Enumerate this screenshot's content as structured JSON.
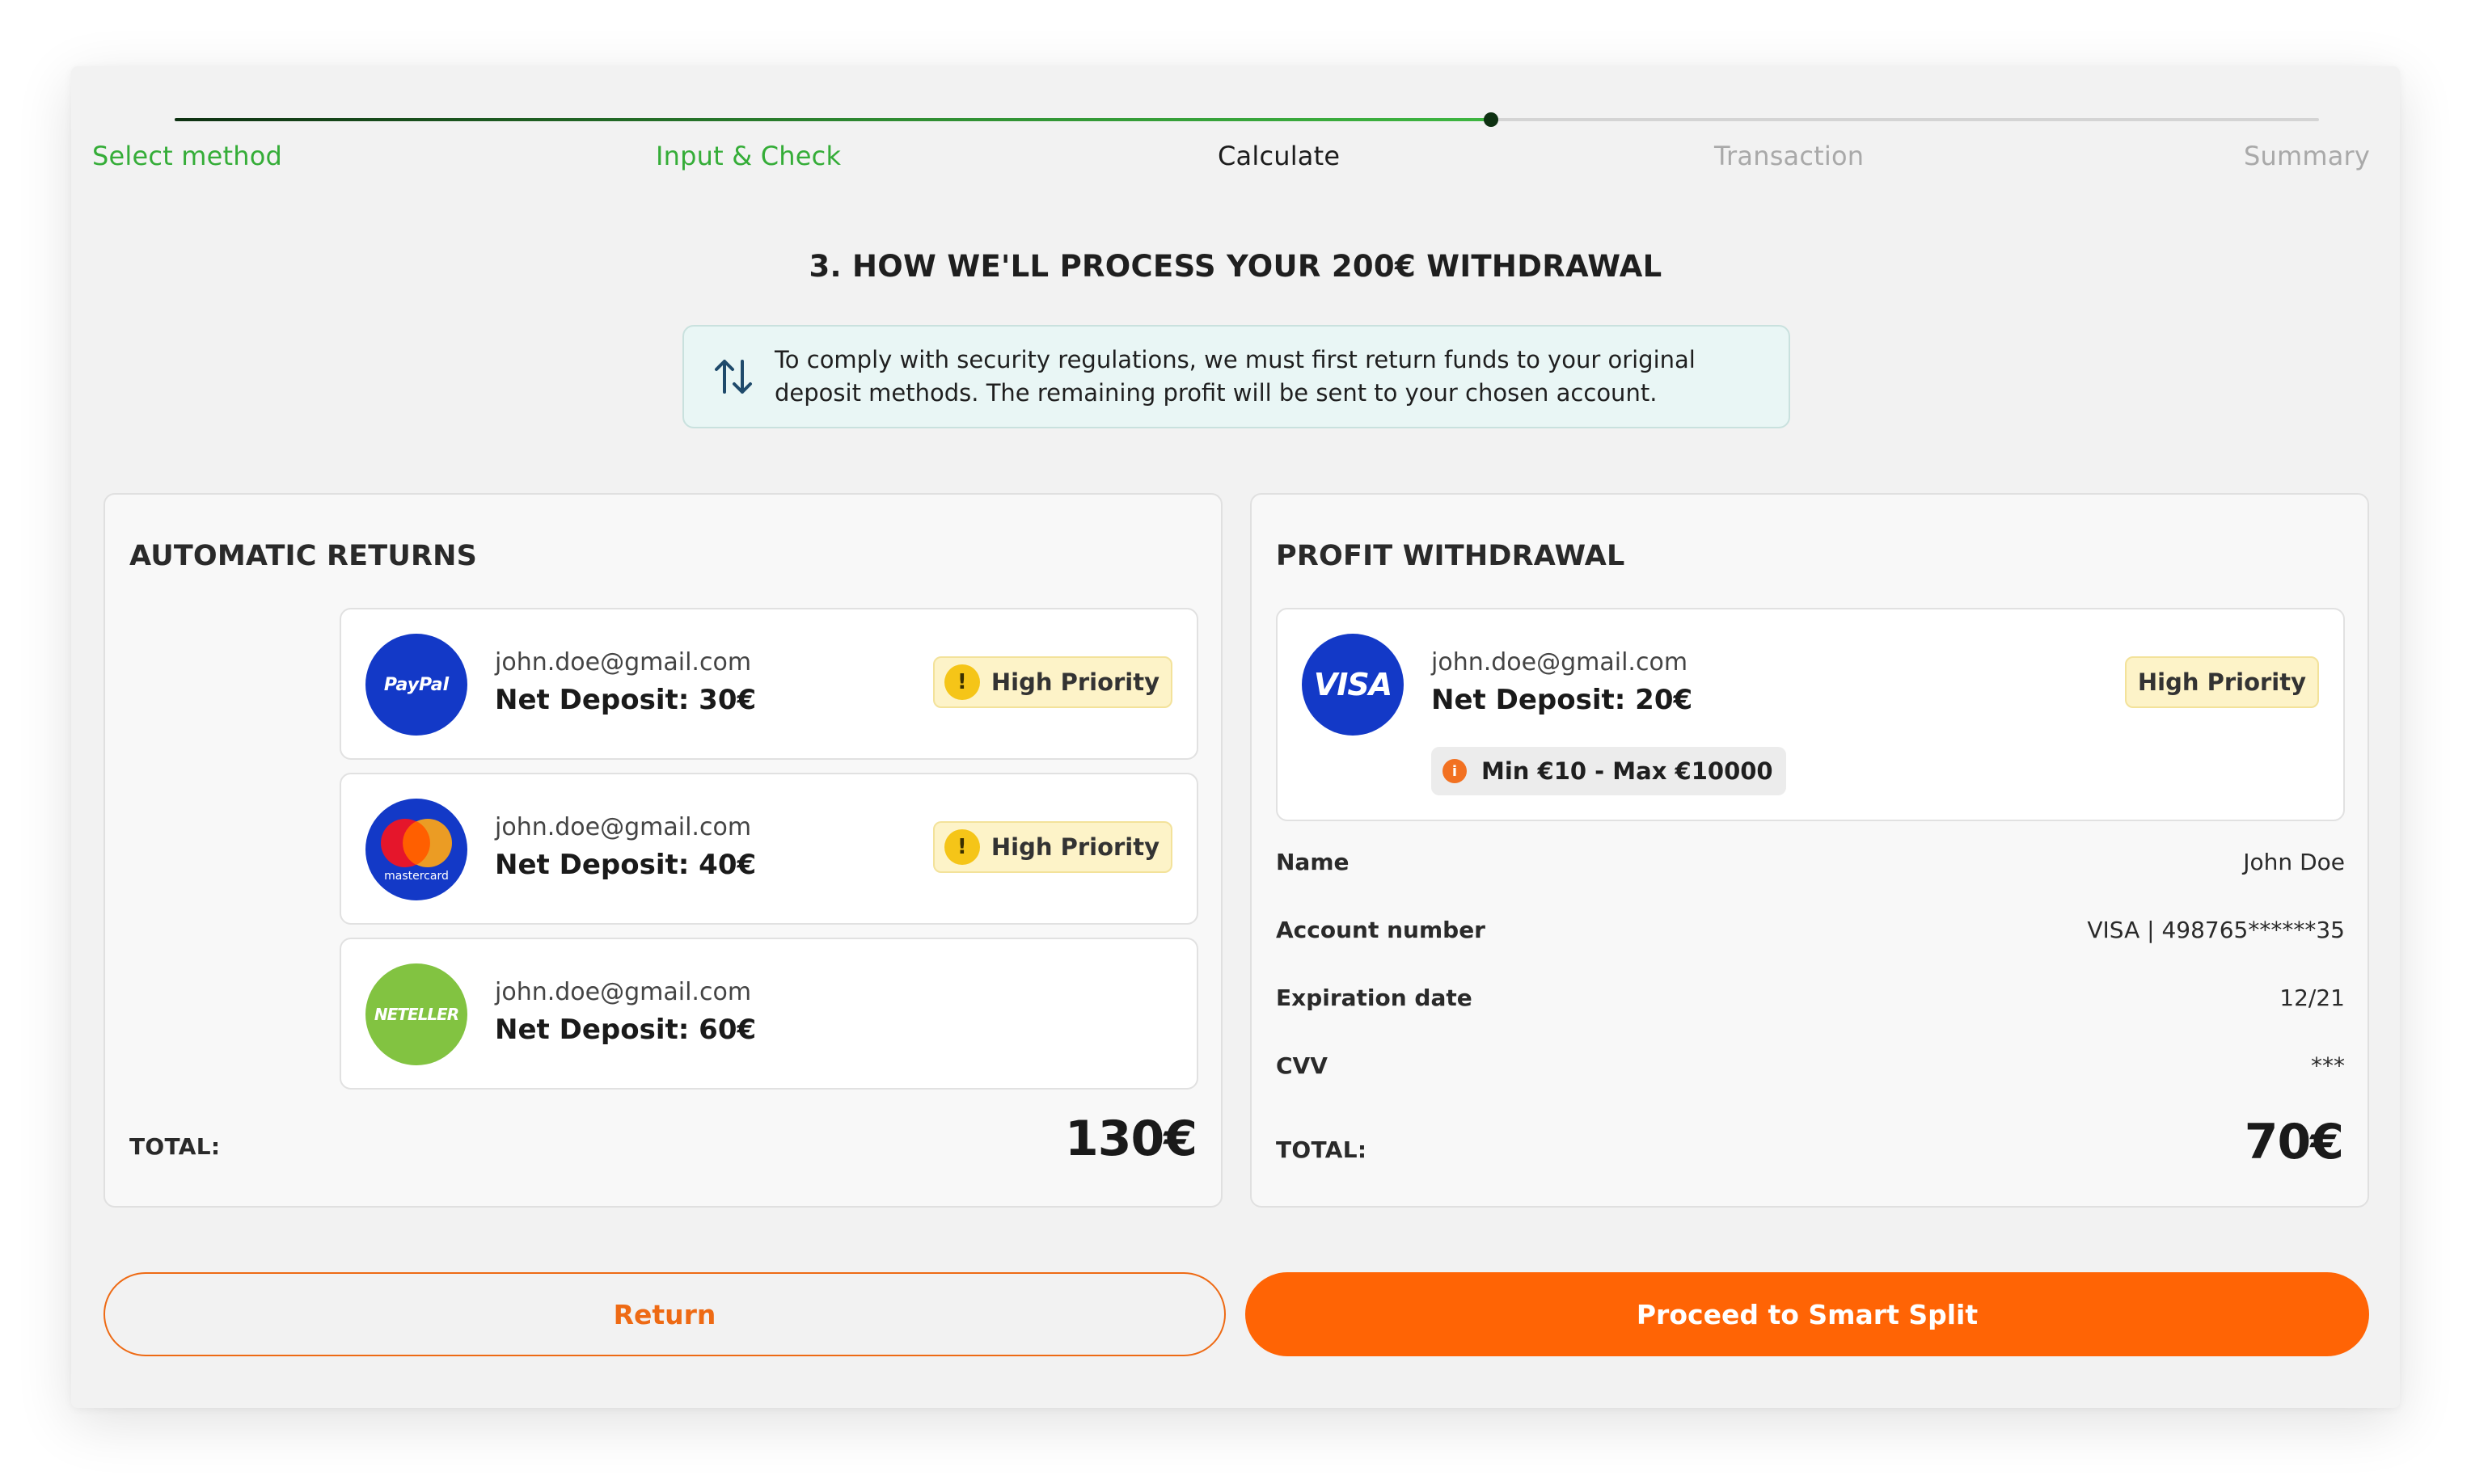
{
  "steps": [
    {
      "label": "Select method",
      "state": "done"
    },
    {
      "label": "Input & Check",
      "state": "done"
    },
    {
      "label": "Calculate",
      "state": "current"
    },
    {
      "label": "Transaction",
      "state": "pending"
    },
    {
      "label": "Summary",
      "state": "pending"
    }
  ],
  "progress": {
    "completed_steps": 2,
    "current_step": 3,
    "total_steps": 5
  },
  "title": "3. HOW WE'LL PROCESS YOUR 200€ WITHDRAWAL",
  "notice": {
    "icon": "swap-vertical-icon",
    "text": "To comply with security regulations, we must first return funds to your original deposit methods. The remaining profit will be sent to your chosen account."
  },
  "automatic_returns": {
    "title": "AUTOMATIC RETURNS",
    "items": [
      {
        "logo": "paypal-logo",
        "logo_text": "PayPal",
        "email": "john.doe@gmail.com",
        "deposit": "Net Deposit: 30€",
        "badge": "High Priority"
      },
      {
        "logo": "mastercard-logo",
        "logo_text": "mastercard",
        "email": "john.doe@gmail.com",
        "deposit": "Net Deposit: 40€",
        "badge": "High Priority"
      },
      {
        "logo": "neteller-logo",
        "logo_text": "NETELLER",
        "email": "john.doe@gmail.com",
        "deposit": "Net Deposit: 60€"
      }
    ],
    "total_label": "TOTAL:",
    "total_value": "130€"
  },
  "profit_withdrawal": {
    "title": "PROFIT WITHDRAWAL",
    "card": {
      "logo": "visa-logo",
      "logo_text": "VISA",
      "email": "john.doe@gmail.com",
      "deposit": "Net Deposit: 20€",
      "badge": "High Priority",
      "limits": "Min €10 - Max €10000"
    },
    "details": [
      {
        "label": "Name",
        "value": "John Doe"
      },
      {
        "label": "Account number",
        "value": "VISA | 498765******35"
      },
      {
        "label": "Expiration date",
        "value": "12/21"
      },
      {
        "label": "CVV",
        "value": "***"
      }
    ],
    "total_label": "TOTAL:",
    "total_value": "70€"
  },
  "buttons": {
    "return": "Return",
    "proceed": "Proceed to Smart Split"
  },
  "colors": {
    "accent": "#ff6405",
    "success": "#35ad38",
    "badge_bg": "#fdf3c8",
    "brand_blue": "#1339c7",
    "neteller_green": "#82c341"
  }
}
